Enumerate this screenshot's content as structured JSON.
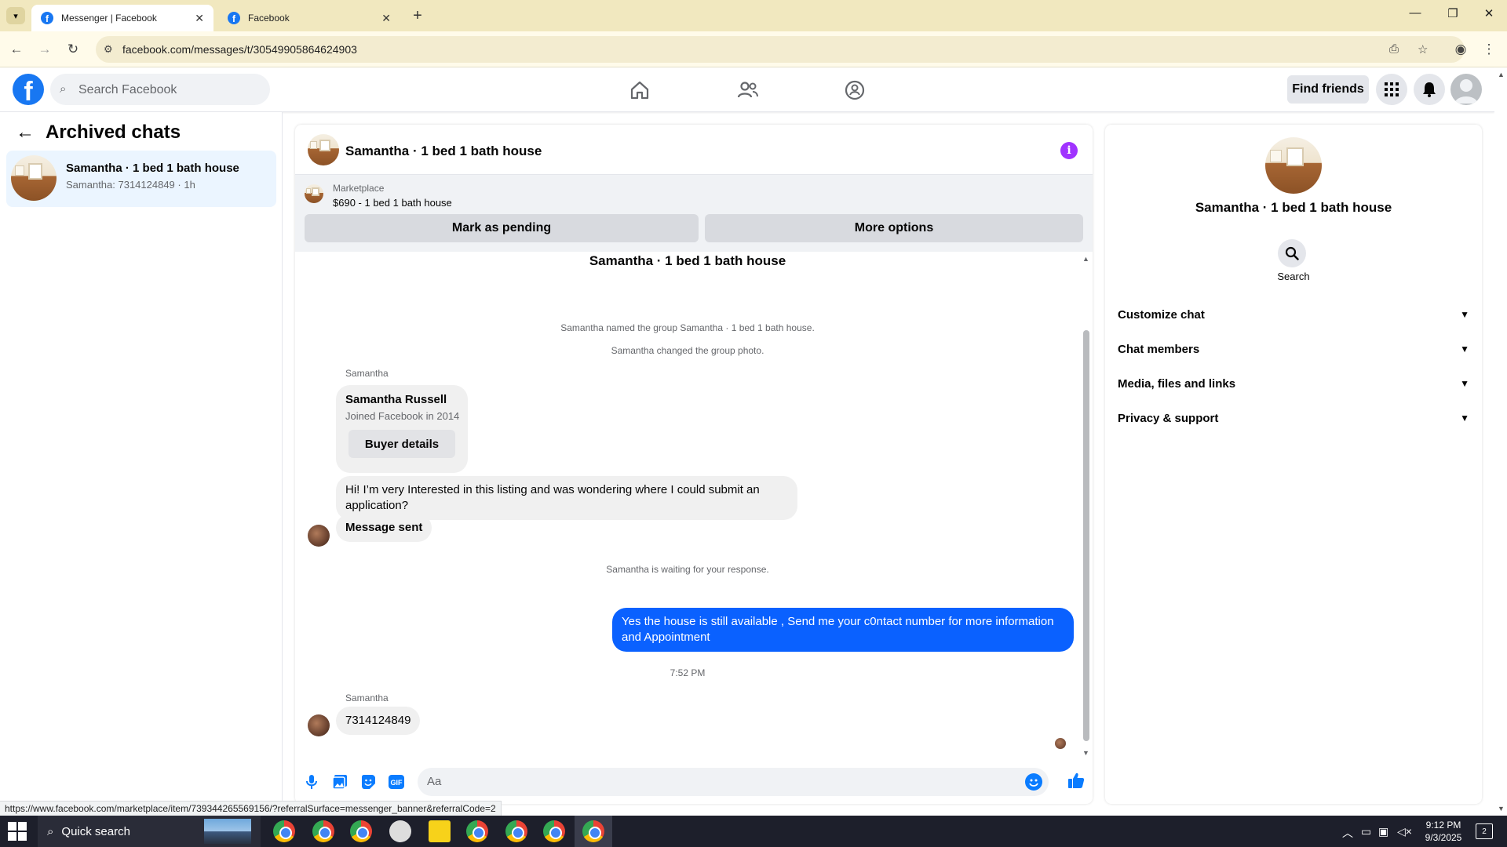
{
  "browser": {
    "tabs": [
      {
        "title": "Messenger | Facebook",
        "active": true
      },
      {
        "title": "Facebook",
        "active": false
      }
    ],
    "url": "facebook.com/messages/t/30549905864624903",
    "status_url": "https://www.facebook.com/marketplace/item/739344265569156/?referralSurface=messenger_banner&referralCode=2"
  },
  "header": {
    "search_placeholder": "Search Facebook",
    "find_friends": "Find friends"
  },
  "sidebar": {
    "title": "Archived chats",
    "chats": [
      {
        "name": "Samantha · 1 bed 1 bath house",
        "preview": "Samantha: 7314124849 · 1h"
      }
    ]
  },
  "conversation": {
    "title": "Samantha · 1 bed 1 bath house",
    "marketplace": {
      "label": "Marketplace",
      "listing": "$690 - 1 bed 1 bath house",
      "mark_pending": "Mark as pending",
      "more_options": "More options"
    },
    "thread_title": "Samantha · 1 bed 1 bath house",
    "system_1": "Samantha named the group Samantha · 1 bed 1 bath house.",
    "system_2": "Samantha changed the group photo.",
    "sender_1": "Samantha",
    "buyer_card": {
      "name": "Samantha Russell",
      "joined": "Joined Facebook in 2014",
      "button": "Buyer details"
    },
    "incoming_1": "Hi! I’m very Interested in this listing and was wondering where I could submit an application?",
    "incoming_2": "Message sent",
    "waiting": "Samantha is waiting for your response.",
    "outgoing_1": "Yes the house is still available , Send me your c0ntact number for more information and Appointment",
    "timestamp": "7:52 PM",
    "sender_2": "Samantha",
    "incoming_3": "7314124849",
    "composer_placeholder": "Aa"
  },
  "info_panel": {
    "name": "Samantha · 1 bed 1 bath house",
    "search_label": "Search",
    "rows": [
      "Customize chat",
      "Chat members",
      "Media, files and links",
      "Privacy & support"
    ]
  },
  "taskbar": {
    "search": "Quick search",
    "time": "9:12 PM",
    "date": "9/3/2025",
    "notifications": "2"
  },
  "colors": {
    "facebook_blue": "#1877f2",
    "outgoing_bubble": "#0a61ff",
    "info_icon": "#a033ff",
    "selected_chat": "#ebf5ff"
  }
}
